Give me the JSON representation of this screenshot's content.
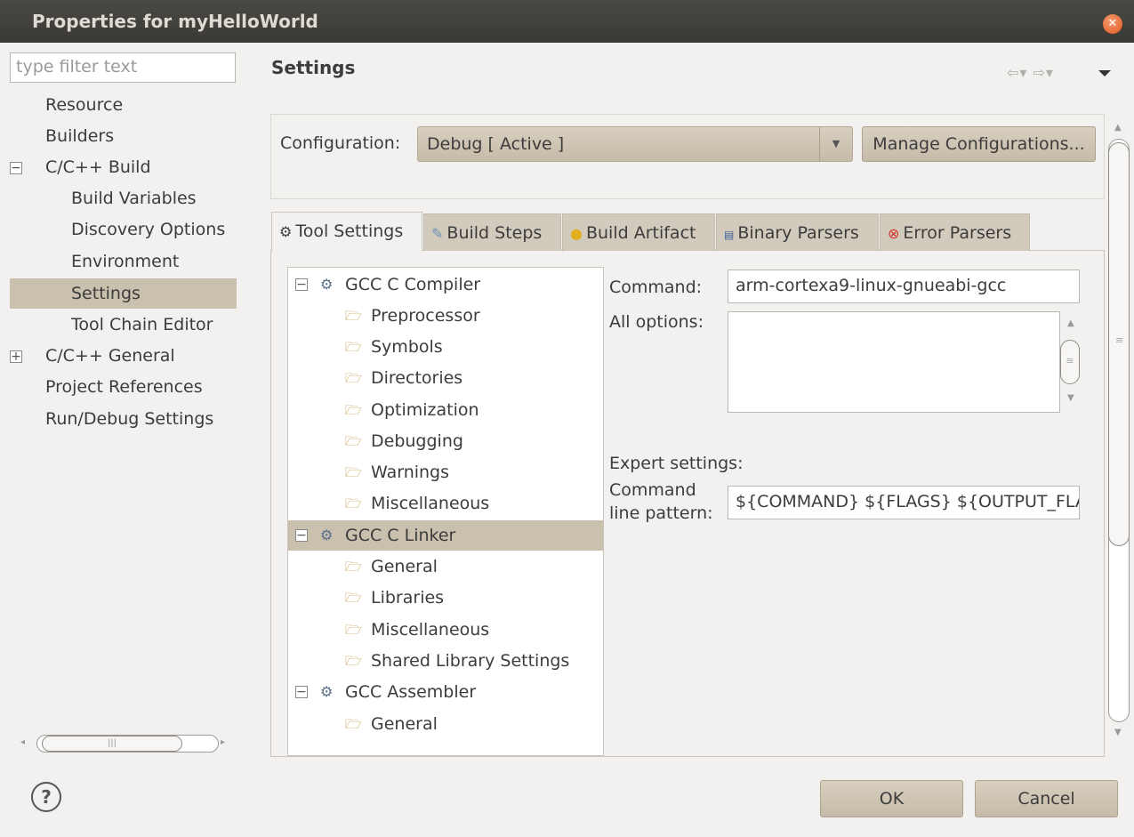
{
  "window": {
    "title": "Properties for myHelloWorld"
  },
  "filter": {
    "placeholder": "type filter text"
  },
  "nav": {
    "items": [
      {
        "label": "Resource"
      },
      {
        "label": "Builders"
      },
      {
        "label": "C/C++ Build",
        "expander": "−"
      },
      {
        "label": "Build Variables"
      },
      {
        "label": "Discovery Options"
      },
      {
        "label": "Environment"
      },
      {
        "label": "Settings",
        "selected": true
      },
      {
        "label": "Tool Chain Editor"
      },
      {
        "label": "C/C++ General",
        "expander": "+"
      },
      {
        "label": "Project References"
      },
      {
        "label": "Run/Debug Settings"
      }
    ]
  },
  "page": {
    "title": "Settings",
    "history_arrows": "⇦▾ ⇨▾"
  },
  "configuration": {
    "label": "Configuration:",
    "selected": "Debug  [ Active ]",
    "manage_button": "Manage Configurations..."
  },
  "tabs": [
    {
      "label": "Tool Settings",
      "icon": "gear-icon",
      "active": true
    },
    {
      "label": "Build Steps",
      "icon": "build-steps-icon"
    },
    {
      "label": "Build Artifact",
      "icon": "artifact-icon"
    },
    {
      "label": "Binary Parsers",
      "icon": "binary-parser-icon"
    },
    {
      "label": "Error Parsers",
      "icon": "error-icon"
    }
  ],
  "tool_tree": {
    "groups": [
      {
        "label": "GCC C Compiler",
        "expander": "−",
        "children": [
          "Preprocessor",
          "Symbols",
          "Directories",
          "Optimization",
          "Debugging",
          "Warnings",
          "Miscellaneous"
        ]
      },
      {
        "label": "GCC C Linker",
        "expander": "−",
        "selected": true,
        "children": [
          "General",
          "Libraries",
          "Miscellaneous",
          "Shared Library Settings"
        ]
      },
      {
        "label": "GCC Assembler",
        "expander": "−",
        "children": [
          "General"
        ]
      }
    ]
  },
  "tool_settings": {
    "command_label": "Command:",
    "command_value": "arm-cortexa9-linux-gnueabi-gcc",
    "all_options_label": "All options:",
    "all_options_value": "",
    "expert_label": "Expert settings:",
    "pattern_label_1": "Command",
    "pattern_label_2": "line pattern:",
    "pattern_value": "${COMMAND} ${FLAGS} ${OUTPUT_FLAG} ${OUTPUT_PREFIX}${OUTPUT} ${INPUTS}"
  },
  "buttons": {
    "ok": "OK",
    "cancel": "Cancel",
    "help": "?"
  },
  "colors": {
    "title_bar": "#3c3b37",
    "selection": "#c9c0ae",
    "button": "#cfc6b6",
    "close": "#e8622c"
  }
}
